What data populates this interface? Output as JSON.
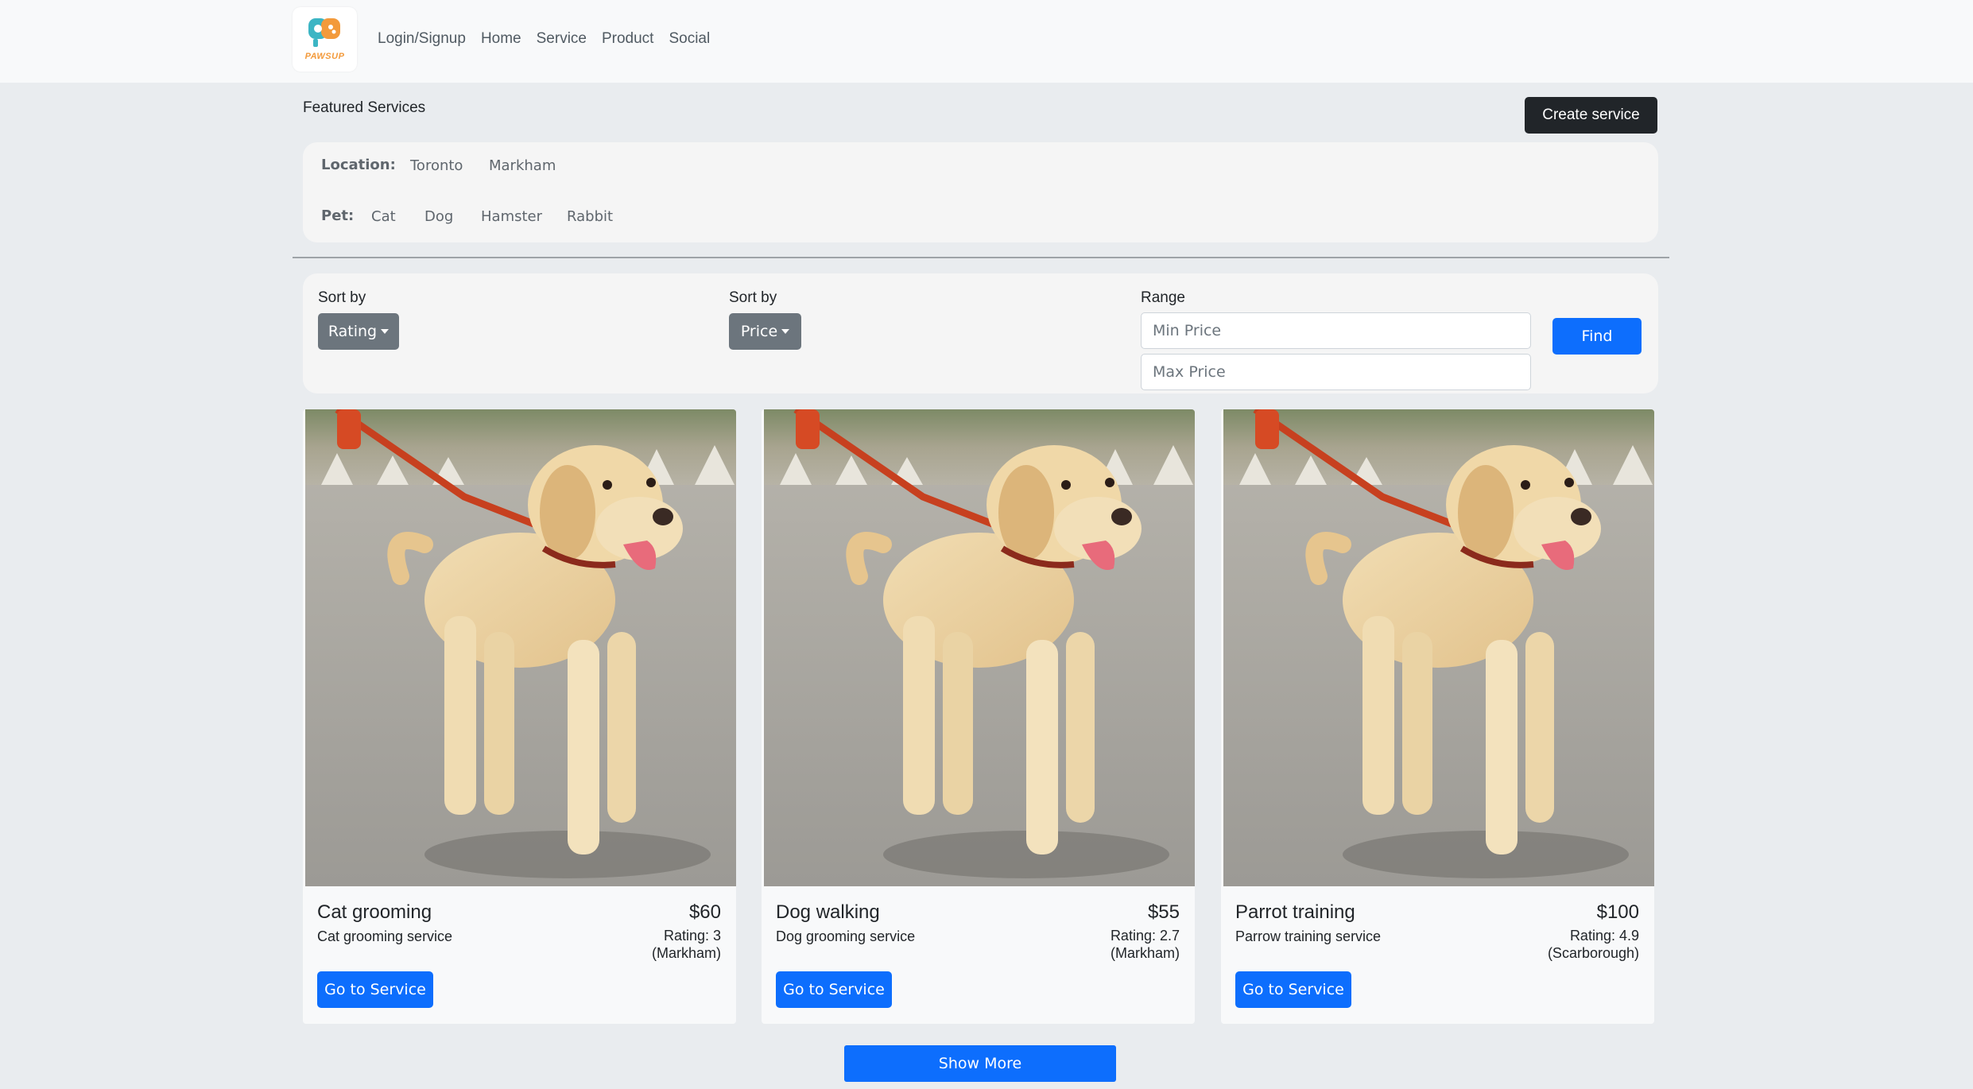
{
  "navbar": {
    "logo_text": "PAWSUP",
    "links": [
      "Login/Signup",
      "Home",
      "Service",
      "Product",
      "Social"
    ]
  },
  "header": {
    "title": "Featured Services",
    "create_label": "Create service"
  },
  "filters": {
    "location_label": "Location:",
    "locations": [
      "Toronto",
      "Markham"
    ],
    "pet_label": "Pet:",
    "pets": [
      "Cat",
      "Dog",
      "Hamster",
      "Rabbit"
    ]
  },
  "sort": {
    "rating_label": "Sort by",
    "rating_button": "Rating",
    "price_label": "Sort by",
    "price_button": "Price",
    "range_label": "Range",
    "min_placeholder": "Min Price",
    "max_placeholder": "Max Price",
    "find_label": "Find"
  },
  "cards": [
    {
      "title": "Cat grooming",
      "price": "$60",
      "description": "Cat grooming service",
      "rating": "Rating: 3",
      "location": "(Markham)",
      "button": "Go to Service"
    },
    {
      "title": "Dog walking",
      "price": "$55",
      "description": "Dog grooming service",
      "rating": "Rating: 2.7",
      "location": "(Markham)",
      "button": "Go to Service"
    },
    {
      "title": "Parrot training",
      "price": "$100",
      "description": "Parrow training service",
      "rating": "Rating: 4.9",
      "location": "(Scarborough)",
      "button": "Go to Service"
    }
  ],
  "show_more_label": "Show More",
  "colors": {
    "primary": "#0d6efd",
    "dark": "#212529",
    "secondary": "#6c757d",
    "logo_teal": "#3cb5c4",
    "logo_orange": "#f39a3b"
  }
}
